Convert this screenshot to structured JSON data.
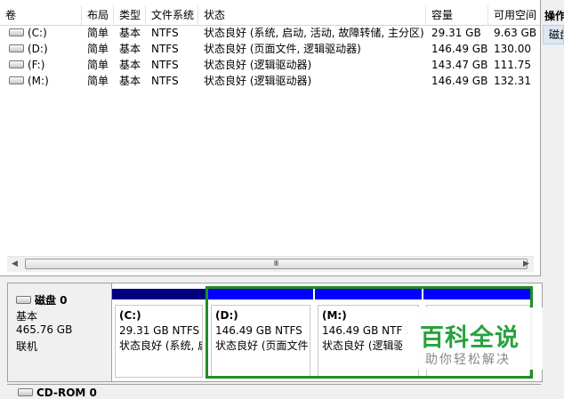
{
  "columns": [
    "卷",
    "布局",
    "类型",
    "文件系统",
    "状态",
    "容量",
    "可用空间"
  ],
  "volumes": [
    {
      "name": "(C:)",
      "layout": "简单",
      "type": "基本",
      "fs": "NTFS",
      "status": "状态良好 (系统, 启动, 活动, 故障转储, 主分区)",
      "capacity": "29.31 GB",
      "free": "9.63 GB"
    },
    {
      "name": "(D:)",
      "layout": "简单",
      "type": "基本",
      "fs": "NTFS",
      "status": "状态良好 (页面文件, 逻辑驱动器)",
      "capacity": "146.49 GB",
      "free": "130.00"
    },
    {
      "name": "(F:)",
      "layout": "简单",
      "type": "基本",
      "fs": "NTFS",
      "status": "状态良好 (逻辑驱动器)",
      "capacity": "143.47 GB",
      "free": "111.75"
    },
    {
      "name": "(M:)",
      "layout": "简单",
      "type": "基本",
      "fs": "NTFS",
      "status": "状态良好 (逻辑驱动器)",
      "capacity": "146.49 GB",
      "free": "132.31"
    }
  ],
  "scrollbar": {
    "left_arrow": "◀",
    "right_arrow": "▶",
    "thumb_grip": "Ⅲ"
  },
  "actions": {
    "title": "操作",
    "item": "磁盘"
  },
  "disk0": {
    "name": "磁盘 0",
    "type": "基本",
    "size": "465.76 GB",
    "state": "联机"
  },
  "partitions": [
    {
      "label": "(C:)",
      "size": "29.31 GB NTFS",
      "status": "状态良好 (系统, 启",
      "bar_color": "#000080"
    },
    {
      "label": "(D:)",
      "size": "146.49 GB NTFS",
      "status": "状态良好 (页面文件",
      "bar_color": "#0000ff"
    },
    {
      "label": "(M:)",
      "size": "146.49 GB NTFS",
      "status": "状态良好 (逻辑驱",
      "bar_color": "#0000ff"
    },
    {
      "label": "",
      "size": "",
      "status": "",
      "bar_color": "#0000ff"
    }
  ],
  "cdrom": {
    "label": "CD-ROM 0"
  },
  "watermark": {
    "main": "百科全说",
    "sub": "助你轻松解决"
  },
  "colors": {
    "selection": "#1f8f1f",
    "primary_bar": "#000080",
    "logical_bar": "#0000ff",
    "watermark_green": "#27a33e"
  }
}
